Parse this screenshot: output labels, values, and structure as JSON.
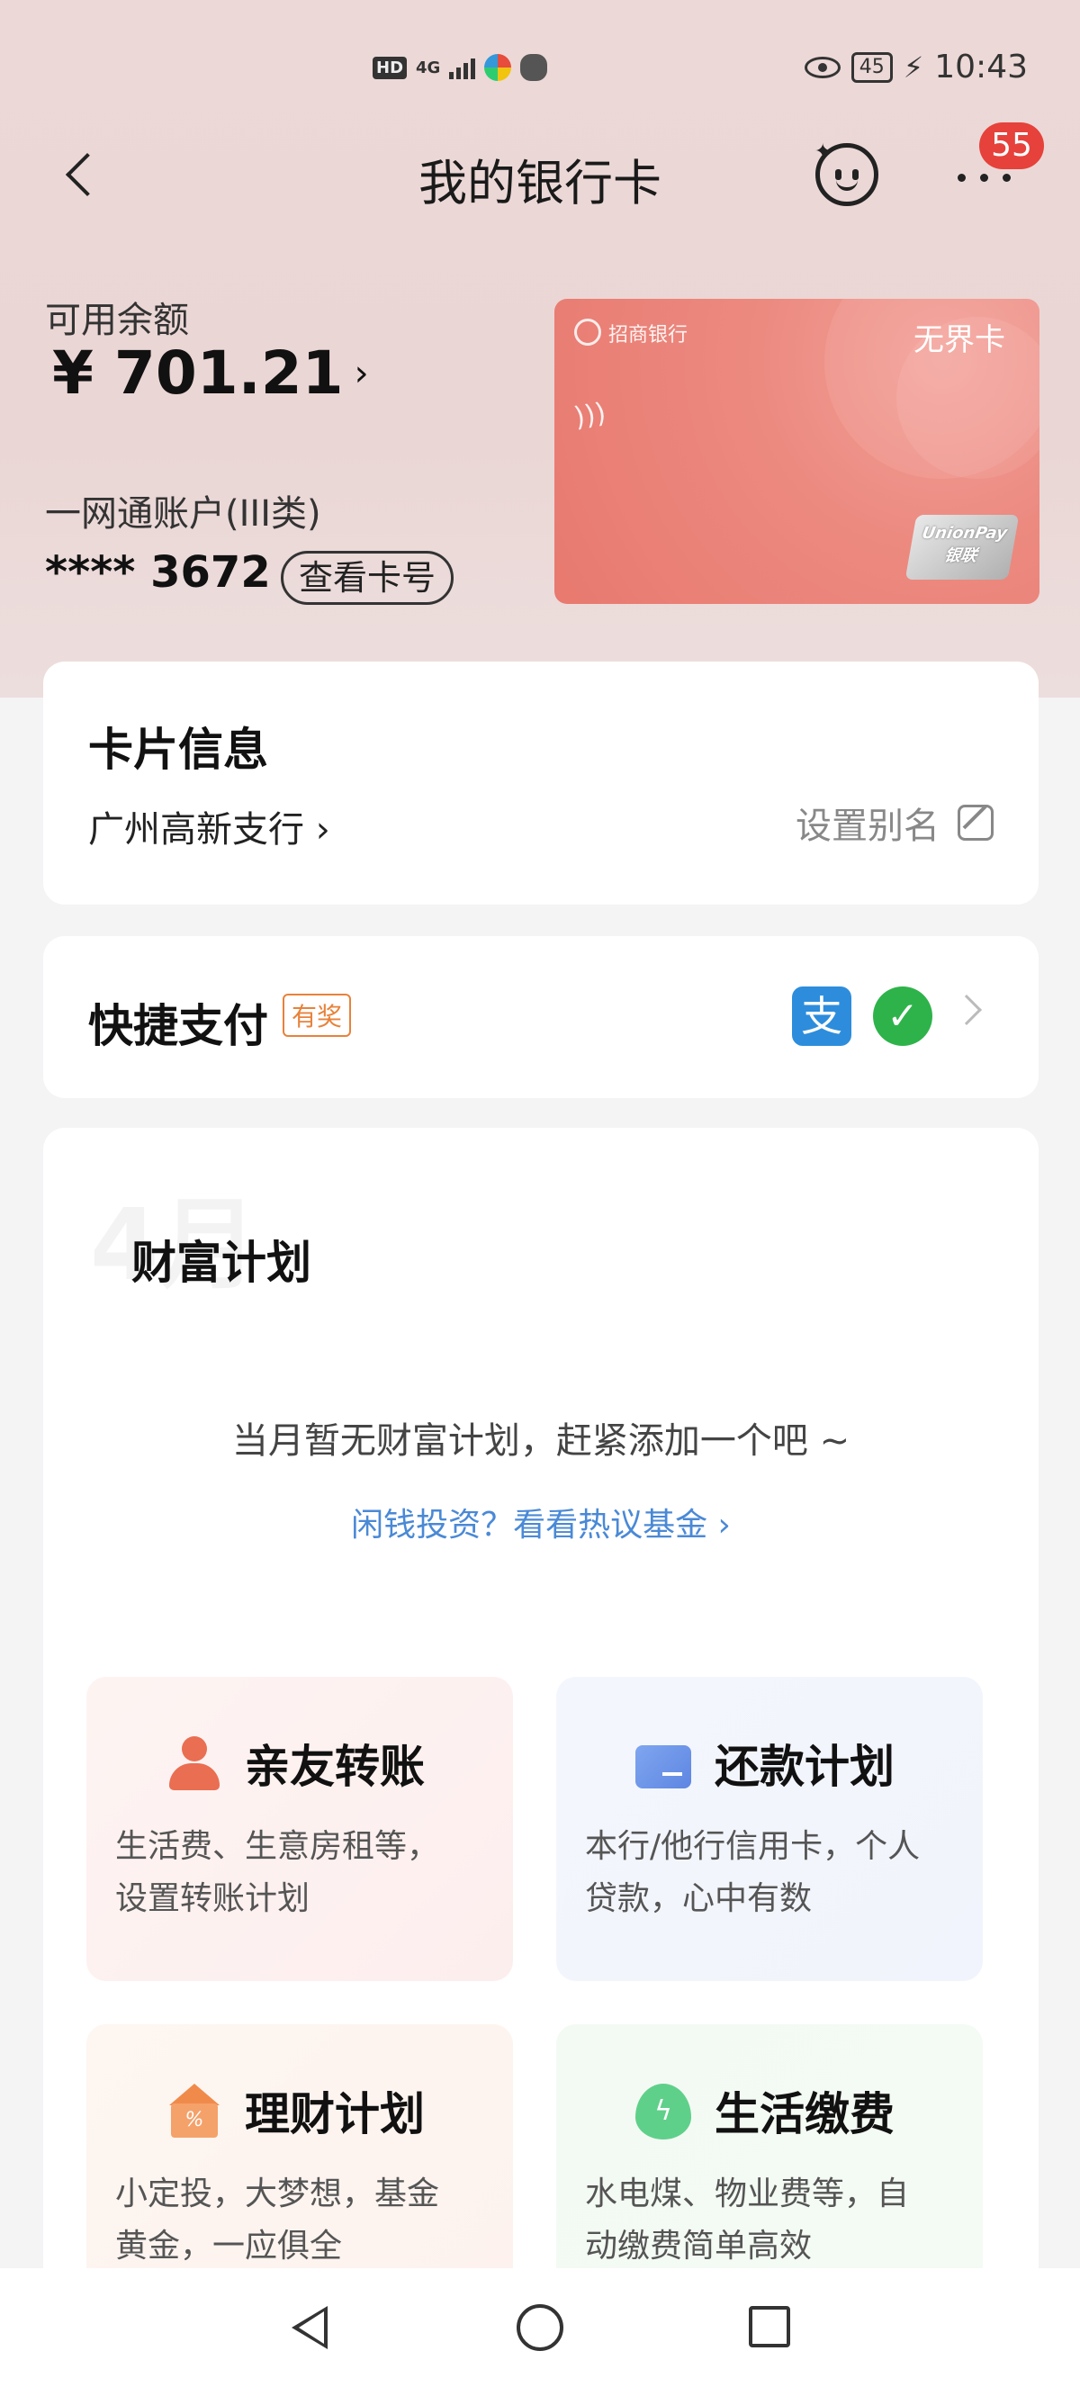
{
  "status_bar": {
    "hd": "HD",
    "network": "4G",
    "battery": "45",
    "time": "10:43"
  },
  "header": {
    "title": "我的银行卡",
    "notification_count": "55"
  },
  "balance": {
    "label": "可用余额",
    "amount": "¥ 701.21"
  },
  "account": {
    "type": "一网通账户(III类)",
    "masked_number": "**** 3672",
    "view_card_label": "查看卡号"
  },
  "bank_card": {
    "bank_name": "招商银行",
    "tier": "无界卡",
    "network_top": "UnionPay",
    "network_bottom": "银联"
  },
  "card_info": {
    "title": "卡片信息",
    "branch": "广州高新支行",
    "alias_label": "设置别名"
  },
  "quick_pay": {
    "title": "快捷支付",
    "tag": "有奖",
    "alipay_glyph": "支",
    "wechat_glyph": "✓"
  },
  "wealth": {
    "month": "4月",
    "title": "财富计划",
    "empty_text": "当月暂无财富计划，赶紧添加一个吧 ~",
    "link_text": "闲钱投资？看看热议基金",
    "features": [
      {
        "title": "亲友转账",
        "desc": [
          "生活费、生意房租等，",
          "设置转账计划"
        ]
      },
      {
        "title": "还款计划",
        "desc": [
          "本行/他行信用卡，个人",
          "贷款，心中有数"
        ]
      },
      {
        "title": "理财计划",
        "desc": [
          "小定投，大梦想，基金",
          "黄金，一应俱全"
        ]
      },
      {
        "title": "生活缴费",
        "desc": [
          "水电煤、物业费等，自",
          "动缴费简单高效"
        ]
      }
    ]
  },
  "colors": {
    "accent_red": "#e6413b",
    "link_blue": "#4a89d6",
    "tag_orange": "#e8823a",
    "card_pink": "#ec8a80"
  }
}
